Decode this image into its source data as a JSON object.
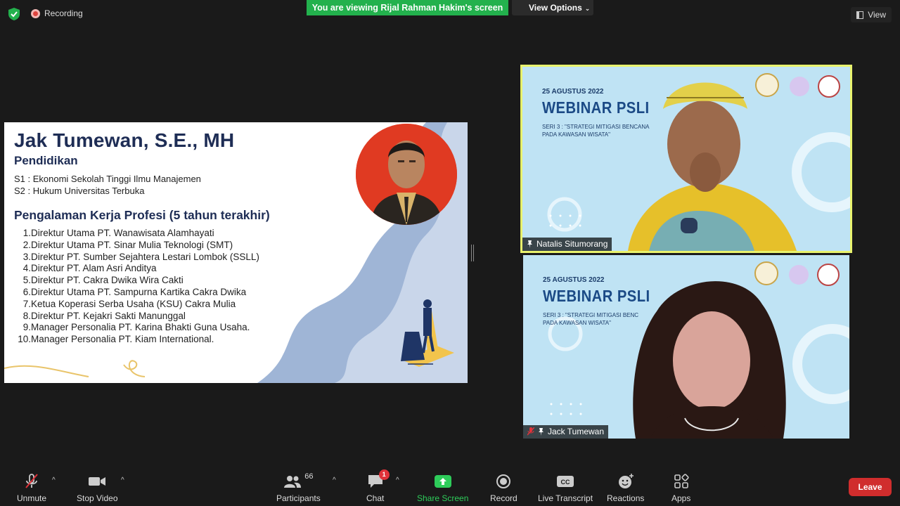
{
  "top_bar": {
    "recording_label": "Recording",
    "viewing_banner": "You are viewing Rijal Rahman Hakim's screen",
    "view_options_label": "View Options",
    "view_label": "View"
  },
  "slide": {
    "name": "Jak Tumewan, S.E., MH",
    "education_heading": "Pendidikan",
    "education": [
      "S1 : Ekonomi Sekolah Tinggi Ilmu Manajemen",
      "S2 : Hukum Universitas Terbuka"
    ],
    "work_heading": "Pengalaman Kerja Profesi (5 tahun terakhir)",
    "work": [
      {
        "num": "1.",
        "text": "Direktur Utama PT. Wanawisata Alamhayati"
      },
      {
        "num": "2.",
        "text": "Direktur Utama PT. Sinar Mulia Teknologi (SMT)"
      },
      {
        "num": "3.",
        "text": "Direktur PT. Sumber Sejahtera Lestari Lombok (SSLL)"
      },
      {
        "num": "4.",
        "text": "Direktur PT. Alam Asri Anditya"
      },
      {
        "num": "5.",
        "text": "Direktur PT. Cakra Dwika Wira Cakti"
      },
      {
        "num": "6.",
        "text": "Direktur Utama PT. Sampurna Kartika Cakra Dwika"
      },
      {
        "num": "7.",
        "text": "Ketua Koperasi Serba Usaha (KSU) Cakra Mulia"
      },
      {
        "num": "8.",
        "text": "Direktur PT. Kejakri Sakti Manunggal"
      },
      {
        "num": "9.",
        "text": "Manager Personalia PT. Karina Bhakti Guna Usaha."
      },
      {
        "num": "10.",
        "text": "Manager Personalia PT. Kiam International."
      }
    ]
  },
  "tiles": [
    {
      "date": "25 AGUSTUS 2022",
      "title": "WEBINAR PSLI",
      "seri_line1": "SERI 3 : \"STRATEGI MITIGASI BENCANA",
      "seri_line2": "PADA KAWASAN WISATA\"",
      "participant": "Natalis Situmorang"
    },
    {
      "date": "25 AGUSTUS 2022",
      "title": "WEBINAR PSLI",
      "seri_line1": "SERI 3 : \"STRATEGI MITIGASI BENC",
      "seri_line2": "PADA KAWASAN WISATA\"",
      "participant": "Jack Tumewan"
    }
  ],
  "toolbar": {
    "unmute": "Unmute",
    "stop_video": "Stop Video",
    "participants": "Participants",
    "participants_count": "66",
    "chat": "Chat",
    "chat_badge": "1",
    "share_screen": "Share Screen",
    "record": "Record",
    "live_transcript": "Live Transcript",
    "reactions": "Reactions",
    "apps": "Apps",
    "leave": "Leave"
  },
  "colors": {
    "banner_green": "#23b14d",
    "share_green": "#2ecc5a",
    "leave_red": "#d02d2d",
    "active_speaker": "#e8f26c"
  }
}
